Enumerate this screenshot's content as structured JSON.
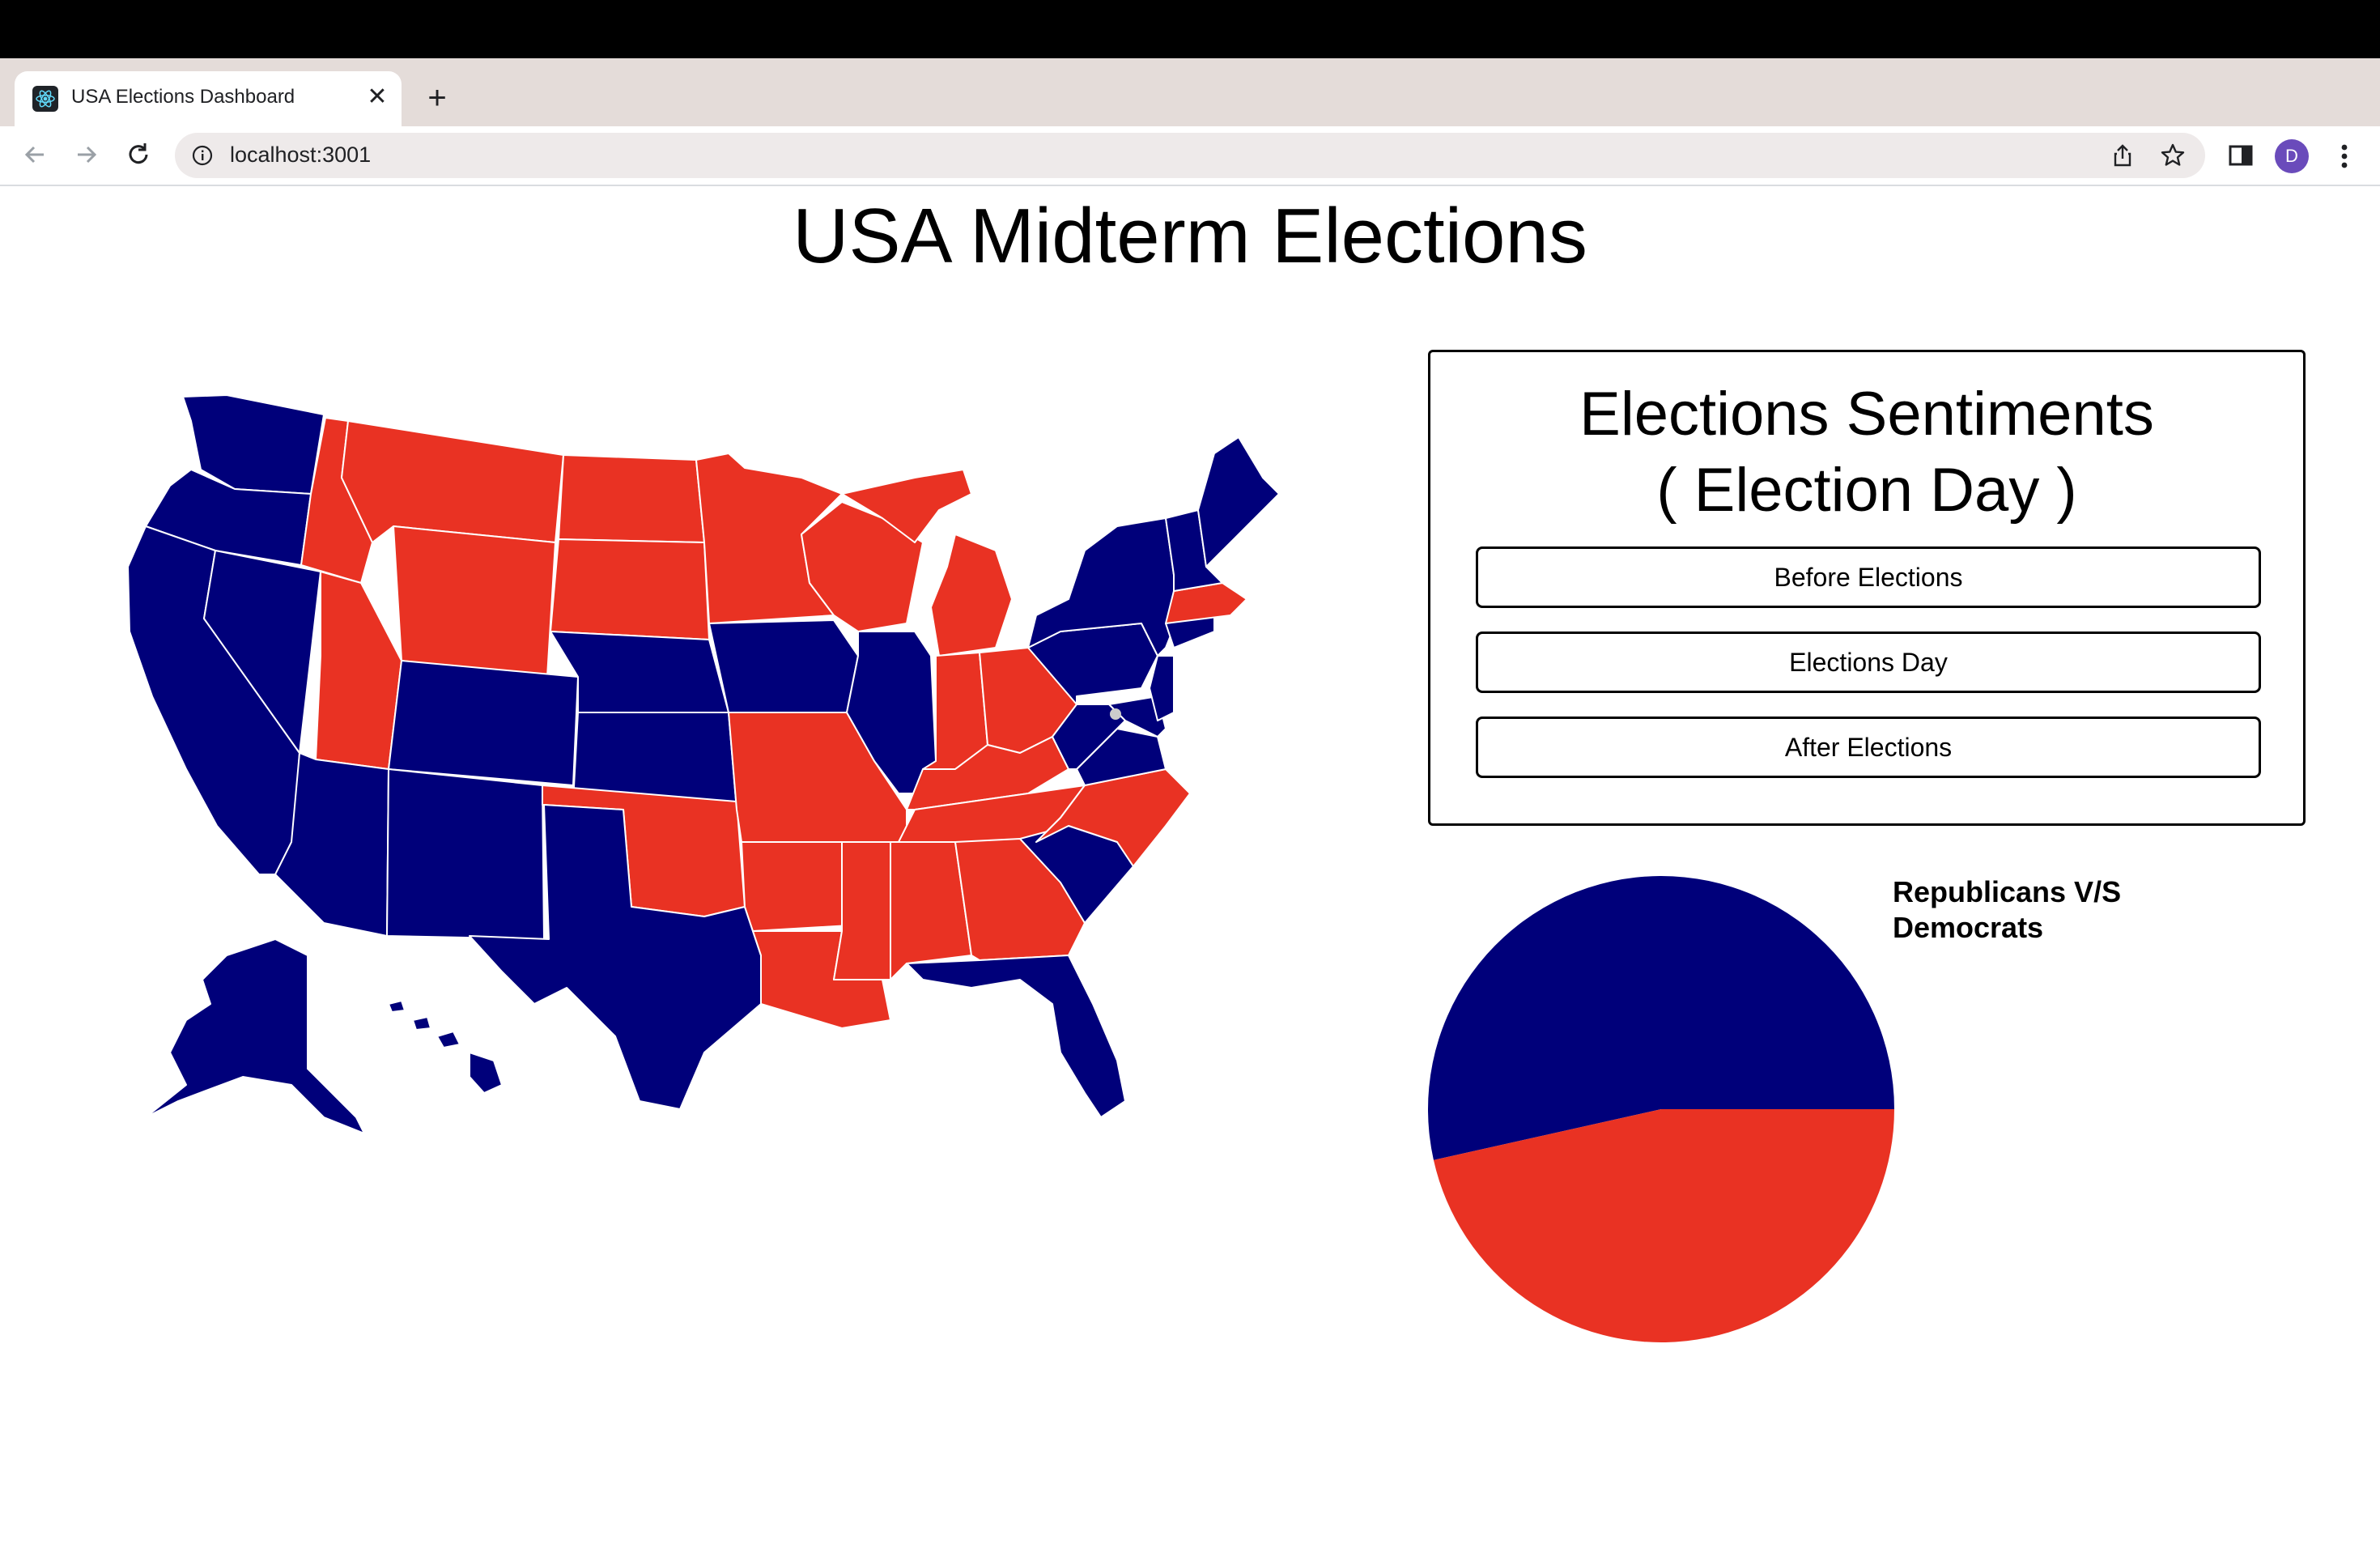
{
  "browser": {
    "tab_title": "USA Elections Dashboard",
    "url": "localhost:3001",
    "profile_initial": "D",
    "icons": [
      "back-icon",
      "forward-icon",
      "reload-icon",
      "info-icon",
      "share-icon",
      "star-icon",
      "side-panel-icon",
      "more-icon",
      "close-icon",
      "plus-icon",
      "chevron-down-icon"
    ]
  },
  "page": {
    "title": "USA Midterm Elections"
  },
  "panel": {
    "title": "Elections Sentiments",
    "subtitle": "( Election Day )",
    "buttons": [
      "Before Elections",
      "Elections Day",
      "After Elections"
    ]
  },
  "colors": {
    "democrat": "#00007a",
    "republican": "#e93223"
  },
  "chart_data": {
    "type": "pie",
    "title": "Republicans V/S Democrats",
    "slices": [
      {
        "name": "Democrats",
        "color": "#00007a",
        "value": 53.5
      },
      {
        "name": "Republicans",
        "color": "#e93223",
        "value": 46.5
      }
    ]
  }
}
